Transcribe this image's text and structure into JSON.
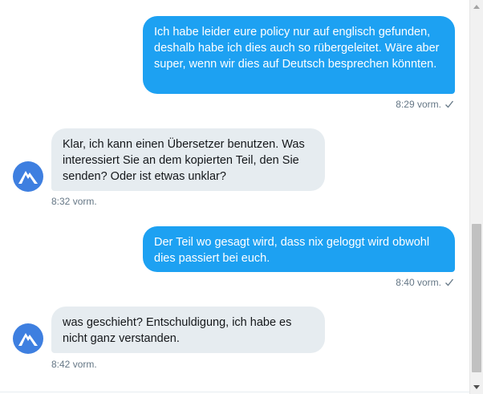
{
  "messages": [
    {
      "direction": "outgoing",
      "text": "Ich habe leider eure policy nur auf englisch gefunden, deshalb habe ich dies auch so rübergeleitet. Wäre aber super, wenn wir dies auf Deutsch besprechen könnten.",
      "time": "8:29 vorm."
    },
    {
      "direction": "incoming",
      "text": "Klar, ich kann einen Übersetzer benutzen. Was interessiert Sie an dem kopierten Teil, den Sie senden? Oder ist etwas unklar?",
      "time": "8:32 vorm."
    },
    {
      "direction": "outgoing",
      "text": "Der Teil wo gesagt wird, dass nix geloggt wird obwohl dies passiert bei euch.",
      "time": "8:40 vorm."
    },
    {
      "direction": "incoming",
      "text": "was geschieht? Entschuldigung, ich habe es nicht ganz verstanden.",
      "time": "8:42 vorm."
    }
  ],
  "icons": {
    "read_receipt": "checkmark-icon",
    "avatar": "nordvpn-mountain-logo",
    "scroll_up": "arrow-up-icon",
    "scroll_down": "arrow-down-icon"
  },
  "colors": {
    "outgoing_bubble": "#1da1f2",
    "incoming_bubble": "#e6ecf0",
    "timestamp": "#657786",
    "avatar_bg": "#3e7fe0"
  }
}
